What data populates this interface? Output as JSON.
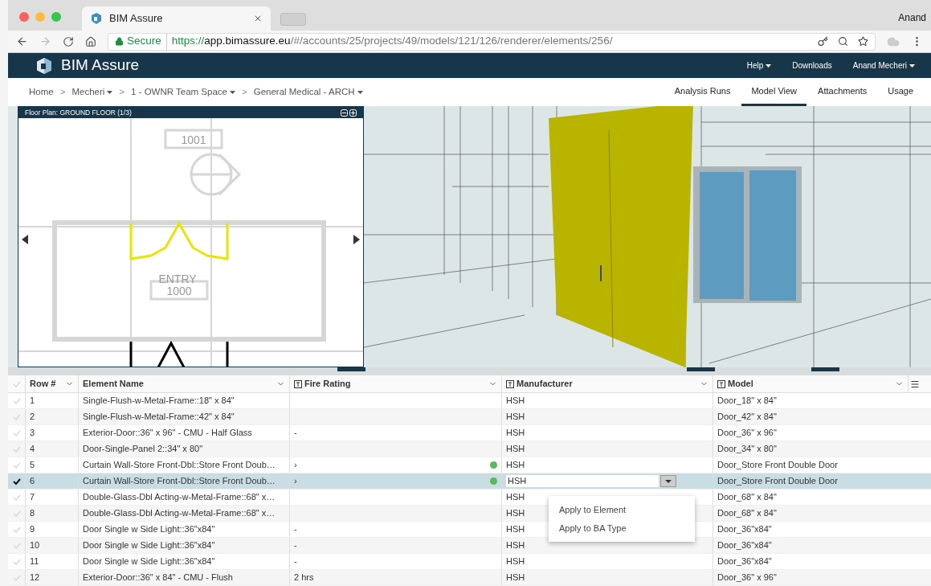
{
  "browser": {
    "tab_title": "BIM Assure",
    "profile": "Anand",
    "url": {
      "secure": "Secure",
      "scheme": "https://",
      "host": "app.bimassure.eu",
      "path": "/#/accounts/25/projects/49/models/121/126/renderer/elements/256/"
    }
  },
  "app": {
    "brand": "BIM Assure",
    "nav": [
      {
        "label": "Help",
        "dropdown": true
      },
      {
        "label": "Downloads",
        "dropdown": false
      },
      {
        "label": "Anand Mecheri",
        "dropdown": true
      }
    ]
  },
  "breadcrumb": [
    {
      "label": "Home",
      "dropdown": false
    },
    {
      "separator": ">",
      "label": "Mecheri",
      "dropdown": true
    },
    {
      "separator": ">",
      "label": "1 - OWNR Team Space",
      "dropdown": true
    },
    {
      "separator": ">",
      "label": "General Medical - ARCH",
      "dropdown": true
    }
  ],
  "view_tabs": [
    {
      "label": "Analysis Runs",
      "selected": false
    },
    {
      "label": "Model View",
      "selected": true
    },
    {
      "label": "Attachments",
      "selected": false
    },
    {
      "label": "Usage",
      "selected": false
    }
  ],
  "floor_plan": {
    "title": "Floor Plan: GROUND FLOOR (1/3)",
    "labels": [
      "1001",
      "ENTRY",
      "1000"
    ]
  },
  "table": {
    "columns": [
      {
        "label": "Row #",
        "typed": false,
        "menu": true
      },
      {
        "label": "Element Name",
        "typed": false,
        "menu": true
      },
      {
        "label": "Fire Rating",
        "typed": true,
        "menu": true
      },
      {
        "label": "Manufacturer",
        "typed": true,
        "menu": true
      },
      {
        "label": "Model",
        "typed": true,
        "menu": true
      }
    ],
    "rows": [
      {
        "row": "1",
        "element_name": "Single-Flush-w-Metal-Frame::18\" x 84\"",
        "manufacturer": "HSH",
        "model": "Door_18\" x 84\"",
        "selected": false
      },
      {
        "row": "2",
        "element_name": "Single-Flush-w-Metal-Frame::42\" x 84\"",
        "manufacturer": "HSH",
        "model": "Door_42\" x 84\"",
        "selected": false
      },
      {
        "row": "3",
        "element_name": "Exterior-Door::36\" x 96\" - CMU - Half Glass",
        "fire_rating": "-",
        "manufacturer": "HSH",
        "model": "Door_36\" x 96\"",
        "selected": false
      },
      {
        "row": "4",
        "element_name": "Door-Single-Panel 2::34\" x 80\"",
        "manufacturer": "HSH",
        "model": "Door_34\" x 80\"",
        "selected": false
      },
      {
        "row": "5",
        "element_name": "Curtain Wall-Store Front-Dbl::Store Front Doub…",
        "fire_rating": "›",
        "color": "#5cb85c",
        "manufacturer": "HSH",
        "model": "Door_Store Front Double Door",
        "selected": false
      },
      {
        "row": "6",
        "element_name": "Curtain Wall-Store Front-Dbl::Store Front Doub…",
        "fire_rating": "›",
        "color": "#5cb85c",
        "manufacturer": "HSH",
        "model": "Door_Store Front Double Door",
        "selected": true,
        "editing": true
      },
      {
        "row": "7",
        "element_name": "Double-Glass-Dbl Acting-w-Metal-Frame::68\" x…",
        "manufacturer": "HSH",
        "model": "Door_68\" x 84\"",
        "selected": false
      },
      {
        "row": "8",
        "element_name": "Double-Glass-Dbl Acting-w-Metal-Frame::68\" x…",
        "manufacturer": "HSH",
        "model": "Door_68\" x 84\"",
        "selected": false
      },
      {
        "row": "9",
        "element_name": "Door Single w Side Light::36\"x84\"",
        "fire_rating": "-",
        "manufacturer": "HSH",
        "model": "Door_36\"x84\"",
        "selected": false
      },
      {
        "row": "10",
        "element_name": "Door Single w Side Light::36\"x84\"",
        "fire_rating": "-",
        "manufacturer": "HSH",
        "model": "Door_36\"x84\"",
        "selected": false
      },
      {
        "row": "11",
        "element_name": "Door Single w Side Light::36\"x84\"",
        "fire_rating": "-",
        "manufacturer": "HSH",
        "model": "Door_36\"x84\"",
        "selected": false
      },
      {
        "row": "12",
        "element_name": "Exterior-Door::36\" x 84\" - CMU - Flush",
        "fire_rating": "2 hrs",
        "manufacturer": "HSH",
        "model": "Door_36\" x 96\"",
        "selected": false
      }
    ],
    "apply_menu": [
      "Apply to Element",
      "Apply to BA Type"
    ]
  }
}
